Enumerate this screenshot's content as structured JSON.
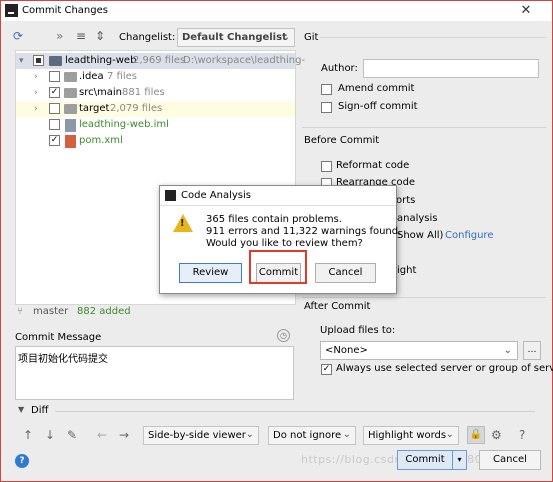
{
  "window": {
    "title": "Commit Changes",
    "close_glyph": "✕"
  },
  "colors": {
    "accent": "#2f6fc6",
    "added_green": "#3c8c2a",
    "warning_yellow": "#e8b61c",
    "highlight_red": "#e03a2d"
  },
  "toolbar": {
    "changelist_label": "Changelist:",
    "changelist_value": "Default Changelist",
    "icons": [
      "refresh-icon",
      "expand-all-icon",
      "collapse-all-icon",
      "group-by-icon"
    ]
  },
  "tree": {
    "root": {
      "name": "leadthing-web",
      "count": "2,969 files",
      "path": "D:\\workspace\\leadthing-"
    },
    "items": [
      {
        "name": ".idea",
        "count": "7 files"
      },
      {
        "name": "src\\main",
        "count": "881 files"
      },
      {
        "name": "target",
        "count": "2,079 files"
      },
      {
        "name": "leadthing-web.iml",
        "count": ""
      },
      {
        "name": "pom.xml",
        "count": ""
      }
    ]
  },
  "branch": {
    "name": "master",
    "added": "882 added"
  },
  "commit_message": {
    "label": "Commit Message",
    "value": "项目初始化代码提交"
  },
  "diff": {
    "label": "Diff",
    "view_mode": "Side-by-side viewer",
    "whitespace": "Do not ignore",
    "highlight": "Highlight words"
  },
  "right_panel": {
    "git_title": "Git",
    "author_label": "Author:",
    "author_value": "",
    "amend_commit": "Amend commit",
    "signoff_commit": "Sign-off commit",
    "before_commit_title": "Before Commit",
    "reformat_code": "Reformat code",
    "rearrange_code": "Rearrange code",
    "optimize_imports_tail": "orts",
    "analysis_tail": "analysis",
    "show_all": "Show All)",
    "configure": "Configure",
    "right_tail": "ight",
    "after_commit_title": "After Commit",
    "upload_label": "Upload files to:",
    "upload_value": "<None>",
    "always_use": "Always use selected server or group of servers"
  },
  "dialog": {
    "title": "Code Analysis",
    "line1": "365 files contain problems.",
    "line2": "911 errors and 11,322 warnings found.",
    "line3": "Would you like to review them?",
    "review": "Review",
    "commit": "Commit",
    "cancel": "Cancel"
  },
  "footer": {
    "help": "?",
    "commit": "Commit",
    "cancel": "Cancel",
    "watermark": "https://blog.csdn.net/u013580126"
  }
}
